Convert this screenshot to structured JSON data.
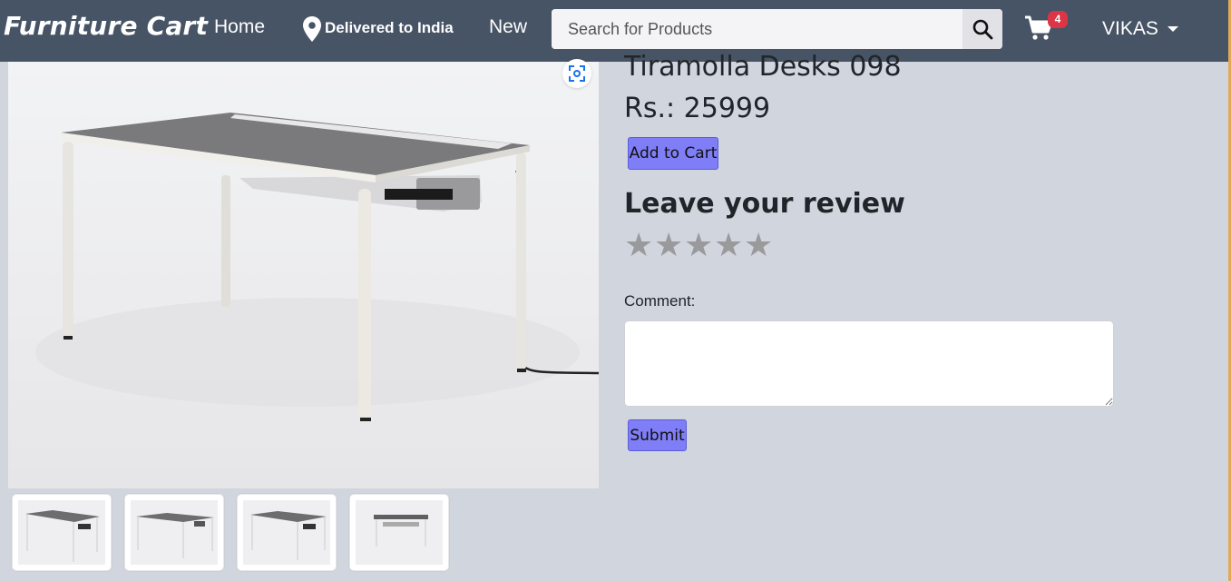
{
  "nav": {
    "brand": "Furniture Cart",
    "home": "Home",
    "delivery": "Delivered to India",
    "new": "New",
    "search_placeholder": "Search for Products",
    "cart_count": "4",
    "user": "VIKAS"
  },
  "product": {
    "title": "Tiramolla Desks 098",
    "price": "Rs.: 25999",
    "add_to_cart": "Add to Cart",
    "thumbnail_count": 4
  },
  "review": {
    "heading": "Leave your review",
    "stars": [
      "★",
      "★",
      "★",
      "★",
      "★"
    ],
    "comment_label": "Comment:",
    "comment_value": "",
    "submit": "Submit"
  },
  "colors": {
    "navbar": "#475466",
    "page": "#d1d5de",
    "button": "#7f7ef6",
    "badge": "#dc3545",
    "star_inactive": "#9a9a9c"
  }
}
